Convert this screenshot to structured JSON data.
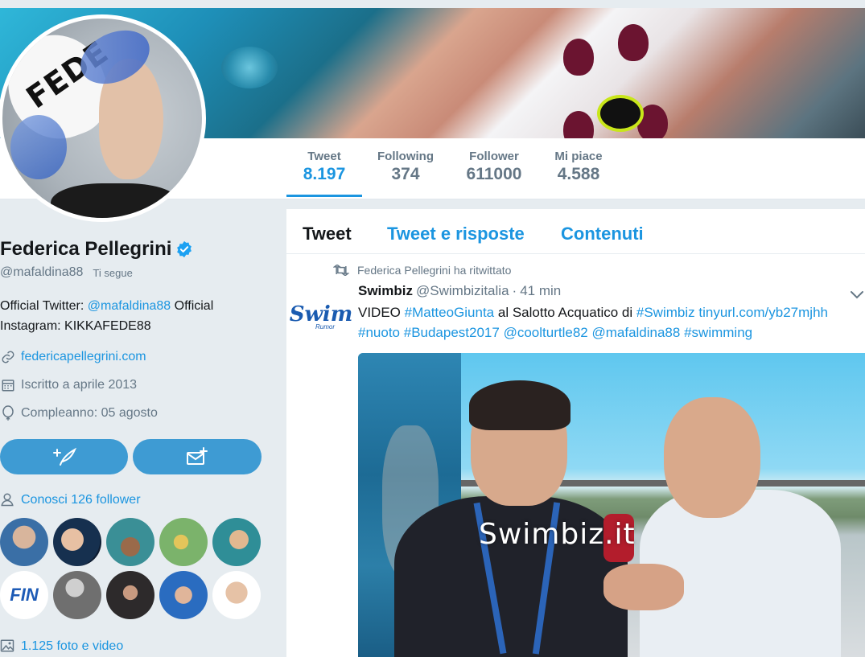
{
  "colors": {
    "accent": "#1b95e0",
    "button": "#3e9bd3",
    "muted": "#657786",
    "background": "#e6ecf0"
  },
  "avatar": {
    "cap_text": "FEDE"
  },
  "nav": {
    "stats": [
      {
        "label": "Tweet",
        "value": "8.197",
        "active": true
      },
      {
        "label": "Following",
        "value": "374",
        "active": false
      },
      {
        "label": "Follower",
        "value": "611000",
        "active": false
      },
      {
        "label": "Mi piace",
        "value": "4.588",
        "active": false
      }
    ]
  },
  "profile": {
    "name": "Federica Pellegrini",
    "verified": true,
    "handle": "@mafaldina88",
    "follows_you": "Ti segue",
    "bio_prefix": "Official Twitter: ",
    "bio_mention": "@mafaldina88",
    "bio_suffix": " Official Instagram: KIKKAFEDE88",
    "website": "federicapellegrini.com",
    "joined": "Iscritto a aprile 2013",
    "birthday": "Compleanno: 05 agosto",
    "known_followers": "Conosci 126 follower",
    "media_link": "1.125 foto e video",
    "follow_icon": "follow-feather-icon",
    "message_icon": "envelope-plus-icon"
  },
  "timeline": {
    "tabs": [
      "Tweet",
      "Tweet e risposte",
      "Contenuti"
    ],
    "retweet_context": "Federica Pellegrini ha ritwittato",
    "tweet": {
      "author_name": "Swimbiz",
      "author_handle": "@Swimbizitalia",
      "dot": "·",
      "time": "41 min",
      "avatar_logo": "Swim",
      "avatar_sub": "Rumor",
      "text_parts": [
        {
          "t": "VIDEO ",
          "ent": false
        },
        {
          "t": "#MatteoGiunta",
          "ent": true
        },
        {
          "t": " al Salotto Acquatico di ",
          "ent": false
        },
        {
          "t": "#Swimbiz",
          "ent": true
        },
        {
          "t": " ",
          "ent": false
        },
        {
          "t": "tinyurl.com/yb27mjhh",
          "ent": true
        },
        {
          "t": " ",
          "ent": false
        },
        {
          "t": "#nuoto",
          "ent": true
        },
        {
          "t": " ",
          "ent": false
        },
        {
          "t": "#Budapest2017",
          "ent": true
        },
        {
          "t": " ",
          "ent": false
        },
        {
          "t": "@coolturtle82",
          "ent": true
        },
        {
          "t": " ",
          "ent": false
        },
        {
          "t": "@mafaldina88",
          "ent": true
        },
        {
          "t": " ",
          "ent": false
        },
        {
          "t": "#swimming",
          "ent": true
        }
      ],
      "media_watermark": "Swimbiz.it"
    }
  }
}
